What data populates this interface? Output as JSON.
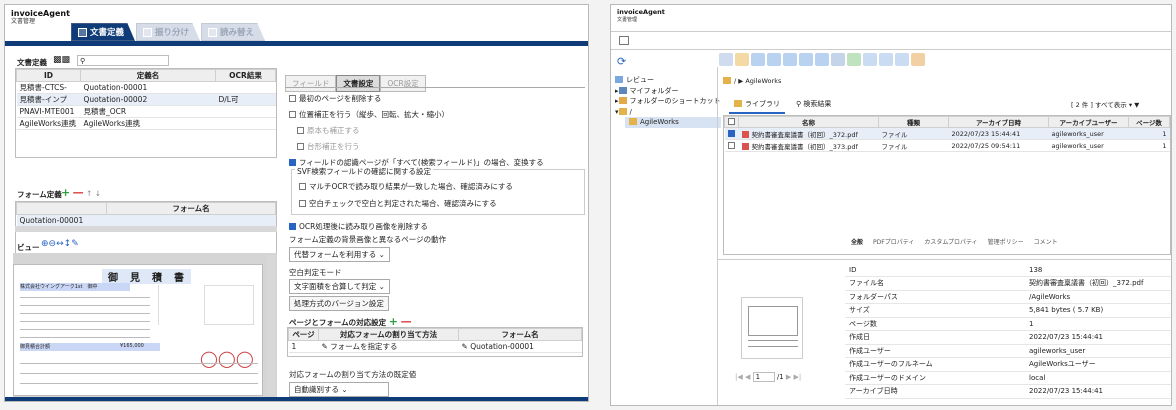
{
  "app": {
    "name": "invoiceAgent",
    "sub1": "文書管理",
    "sub2": "文書管理"
  },
  "left": {
    "tabs": [
      "文書定義",
      "振り分け",
      "読み替え"
    ],
    "doc_def": {
      "label": "文書定義",
      "columns": [
        "ID",
        "定義名",
        "OCR結果"
      ],
      "rows": [
        [
          "見積書-CTCS-",
          "Quotation-00001",
          ""
        ],
        [
          "見積書-インプ",
          "Quotation-00002",
          "D/L可"
        ],
        [
          "PNAVI-MTE001",
          "見積書_OCR",
          ""
        ],
        [
          "AgileWorks連携",
          "AgileWorks連携",
          ""
        ]
      ]
    },
    "form_def": {
      "label": "フォーム定義",
      "column": "フォーム名",
      "rows": [
        "Quotation-00001"
      ]
    },
    "view": {
      "label": "ビュー"
    },
    "preview": {
      "title": "御　見　積　書",
      "company": "株式会社ウイングアーク1st　御中",
      "total_label": "御見積合計額",
      "total": "¥165,000"
    },
    "settings_tabs": [
      "フィールド",
      "文書設定",
      "OCR設定"
    ],
    "options": {
      "o1": "最初のページを削除する",
      "o2": "位置補正を行う（縦歩、回転、拡大・縮小）",
      "o3": "原本も補正する",
      "o4": "台形補正を行う",
      "o5": "フィールドの認識ページが「すべて(検索フィールド)」の場合、変換する",
      "svf_label": "SVF検索フィールドの確認に関する設定",
      "o6": "マルチOCRで読み取り結果が一致した場合、確認済みにする",
      "o7": "空白チェックで空白と判定された場合、確認済みにする",
      "o8": "OCR処理後に読み取り画像を削除する",
      "bg_label": "フォーム定義の背景画像と異なるページの動作",
      "bg_value": "代替フォームを利用する",
      "blank_label": "空白判定モード",
      "blank_value": "文字面積を合算して判定",
      "version_btn": "処理方式のバージョン設定",
      "map_label": "ページとフォームの対応設定",
      "map_cols": [
        "ページ",
        "対応フォームの割り当て方法",
        "フォーム名"
      ],
      "map_row": [
        "1",
        "フォームを指定する",
        "Quotation-00001"
      ],
      "default_label": "対応フォームの割り当て方法の既定値",
      "default_value": "自動識別する"
    }
  },
  "right": {
    "tree": [
      "レビュー",
      "マイフォルダー",
      "フォルダーのショートカット",
      "/",
      "AgileWorks"
    ],
    "breadcrumb": "/ ▶ AgileWorks",
    "tabs": [
      "ライブラリ",
      "検索結果"
    ],
    "count": "[ 2 件 ] すべて表示",
    "columns": [
      "名称",
      "種類",
      "アーカイブ日時",
      "アーカイブユーザー",
      "ページ数"
    ],
    "rows": [
      [
        "契約書審査稟議書（初回）_372.pdf",
        "ファイル",
        "2022/07/23 15:44:41",
        "agileworks_user",
        "1"
      ],
      [
        "契約書審査稟議書（初回）_373.pdf",
        "ファイル",
        "2022/07/25 09:54:11",
        "agileworks_user",
        "1"
      ]
    ],
    "detail_tabs": [
      "全般",
      "PDFプロパティ",
      "カスタムプロパティ",
      "管理ポリシー",
      "コメント"
    ],
    "props": [
      [
        "ID",
        "138"
      ],
      [
        "ファイル名",
        "契約書審査稟議書（初回）_372.pdf"
      ],
      [
        "フォルダーパス",
        "/AgileWorks"
      ],
      [
        "サイズ",
        "5,841 bytes ( 5.7 KB)"
      ],
      [
        "ページ数",
        "1"
      ],
      [
        "作成日",
        "2022/07/23 15:44:41"
      ],
      [
        "作成ユーザー",
        "agileworks_user"
      ],
      [
        "作成ユーザーのフルネーム",
        "AgileWorksユーザー"
      ],
      [
        "作成ユーザーのドメイン",
        "local"
      ],
      [
        "アーカイブ日時",
        "2022/07/23 15:44:41"
      ]
    ],
    "pager": {
      "page": "1",
      "total": "/1"
    }
  }
}
